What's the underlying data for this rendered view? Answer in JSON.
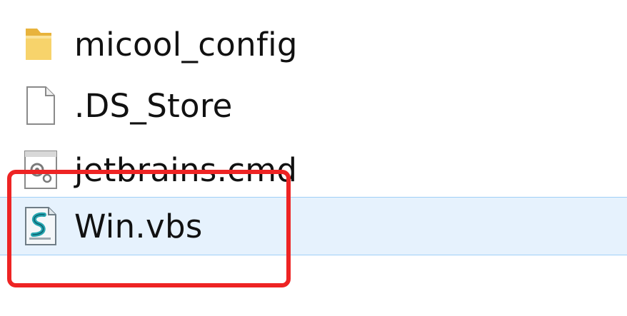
{
  "explorer": {
    "files": [
      {
        "name": "micool_config",
        "icon": "folder-icon",
        "selected": false
      },
      {
        "name": ".DS_Store",
        "icon": "blank-file-icon",
        "selected": false
      },
      {
        "name": "jetbrains.cmd",
        "icon": "cmd-script-icon",
        "selected": false
      },
      {
        "name": "Win.vbs",
        "icon": "vbs-script-icon",
        "selected": true
      }
    ]
  },
  "colors": {
    "selection_background": "#e6f2fd",
    "selection_border": "#9fd0f7",
    "annotation_red": "#ee2424",
    "folder_yellow": "#f5c84c"
  }
}
